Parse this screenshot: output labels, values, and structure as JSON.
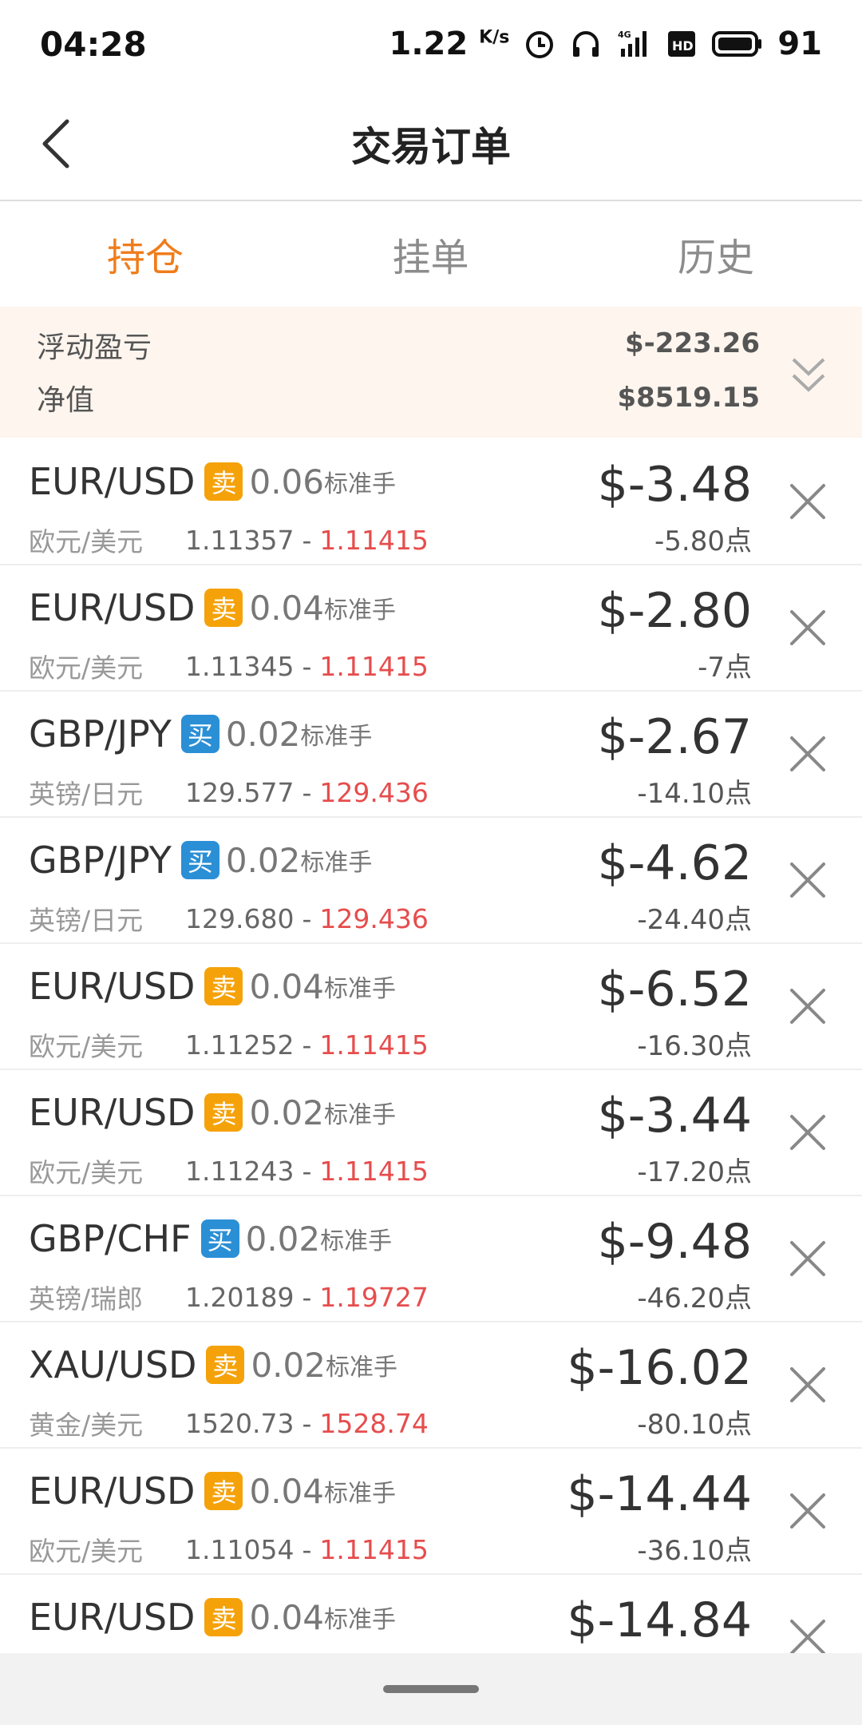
{
  "status_bar": {
    "time": "04:28",
    "speed": "1.22",
    "speed_unit": "K/s",
    "battery": "91",
    "icons": [
      "alarm-icon",
      "headphones-icon",
      "signal-4g-icon",
      "hd-icon",
      "battery-icon"
    ]
  },
  "header": {
    "title": "交易订单",
    "back_icon": "chevron-left-icon"
  },
  "tabs": [
    {
      "label": "持仓",
      "active": true
    },
    {
      "label": "挂单",
      "active": false
    },
    {
      "label": "历史",
      "active": false
    }
  ],
  "summary": {
    "floating_pl_label": "浮动盈亏",
    "floating_pl_value": "$-223.26",
    "equity_label": "净值",
    "equity_value": "$8519.15",
    "expand_icon": "double-chevron-down-icon"
  },
  "colors": {
    "accent": "#f07c1b",
    "sell_badge": "#f5a20a",
    "buy_badge": "#2b8fd6",
    "current_price": "#e64d4d",
    "summary_bg": "#fdf5ee"
  },
  "lot_unit": "标准手",
  "orders": [
    {
      "symbol": "EUR/USD",
      "side": "卖",
      "side_type": "sell",
      "lots": "0.06",
      "name": "欧元/美元",
      "open": "1.11357",
      "sep": "-",
      "current": "1.11415",
      "pnl": "$-3.48",
      "points": "-5.80点"
    },
    {
      "symbol": "EUR/USD",
      "side": "卖",
      "side_type": "sell",
      "lots": "0.04",
      "name": "欧元/美元",
      "open": "1.11345",
      "sep": "-",
      "current": "1.11415",
      "pnl": "$-2.80",
      "points": "-7点"
    },
    {
      "symbol": "GBP/JPY",
      "side": "买",
      "side_type": "buy",
      "lots": "0.02",
      "name": "英镑/日元",
      "open": "129.577",
      "sep": "-",
      "current": "129.436",
      "pnl": "$-2.67",
      "points": "-14.10点"
    },
    {
      "symbol": "GBP/JPY",
      "side": "买",
      "side_type": "buy",
      "lots": "0.02",
      "name": "英镑/日元",
      "open": "129.680",
      "sep": "-",
      "current": "129.436",
      "pnl": "$-4.62",
      "points": "-24.40点"
    },
    {
      "symbol": "EUR/USD",
      "side": "卖",
      "side_type": "sell",
      "lots": "0.04",
      "name": "欧元/美元",
      "open": "1.11252",
      "sep": "-",
      "current": "1.11415",
      "pnl": "$-6.52",
      "points": "-16.30点"
    },
    {
      "symbol": "EUR/USD",
      "side": "卖",
      "side_type": "sell",
      "lots": "0.02",
      "name": "欧元/美元",
      "open": "1.11243",
      "sep": "-",
      "current": "1.11415",
      "pnl": "$-3.44",
      "points": "-17.20点"
    },
    {
      "symbol": "GBP/CHF",
      "side": "买",
      "side_type": "buy",
      "lots": "0.02",
      "name": "英镑/瑞郎",
      "open": "1.20189",
      "sep": "-",
      "current": "1.19727",
      "pnl": "$-9.48",
      "points": "-46.20点"
    },
    {
      "symbol": "XAU/USD",
      "side": "卖",
      "side_type": "sell",
      "lots": "0.02",
      "name": "黄金/美元",
      "open": "1520.73",
      "sep": "-",
      "current": "1528.74",
      "pnl": "$-16.02",
      "points": "-80.10点"
    },
    {
      "symbol": "EUR/USD",
      "side": "卖",
      "side_type": "sell",
      "lots": "0.04",
      "name": "欧元/美元",
      "open": "1.11054",
      "sep": "-",
      "current": "1.11415",
      "pnl": "$-14.44",
      "points": "-36.10点"
    },
    {
      "symbol": "EUR/USD",
      "side": "卖",
      "side_type": "sell",
      "lots": "0.04",
      "name": "",
      "open": "",
      "sep": "",
      "current": "",
      "pnl": "$-14.84",
      "points": ""
    }
  ]
}
